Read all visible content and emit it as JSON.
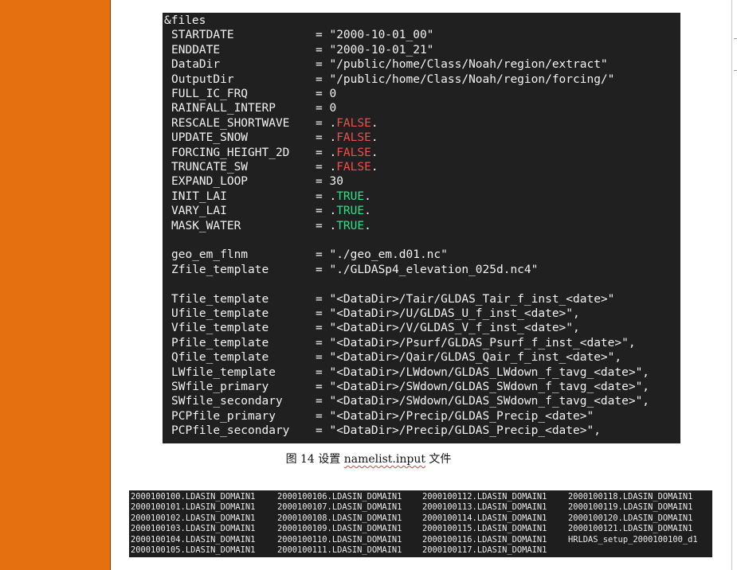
{
  "namelist": {
    "header": "&files",
    "entries": [
      {
        "key": "STARTDATE",
        "eq": "=",
        "value": [
          {
            "t": "\"2000-10-01_00\""
          }
        ]
      },
      {
        "key": "ENDDATE",
        "eq": "=",
        "value": [
          {
            "t": "\"2000-10-01_21\""
          }
        ]
      },
      {
        "key": "DataDir",
        "eq": "=",
        "value": [
          {
            "t": "\"/public/home/Class/Noah/region/extract\""
          }
        ]
      },
      {
        "key": "OutputDir",
        "eq": "=",
        "value": [
          {
            "t": "\"/public/home/Class/Noah/region/forcing/\""
          }
        ]
      },
      {
        "key": "FULL_IC_FRQ",
        "eq": "=",
        "value": [
          {
            "t": "0"
          }
        ]
      },
      {
        "key": "RAINFALL_INTERP",
        "eq": "=",
        "value": [
          {
            "t": "0"
          }
        ]
      },
      {
        "key": "RESCALE_SHORTWAVE",
        "eq": "=",
        "value": [
          {
            "t": "."
          },
          {
            "t": "FALSE",
            "c": "red"
          },
          {
            "t": "."
          }
        ]
      },
      {
        "key": "UPDATE_SNOW",
        "eq": "=",
        "value": [
          {
            "t": "."
          },
          {
            "t": "FALSE",
            "c": "red"
          },
          {
            "t": "."
          }
        ]
      },
      {
        "key": "FORCING_HEIGHT_2D",
        "eq": "=",
        "value": [
          {
            "t": "."
          },
          {
            "t": "FALSE",
            "c": "red"
          },
          {
            "t": "."
          }
        ]
      },
      {
        "key": "TRUNCATE_SW",
        "eq": "=",
        "value": [
          {
            "t": "."
          },
          {
            "t": "FALSE",
            "c": "red"
          },
          {
            "t": "."
          }
        ]
      },
      {
        "key": "EXPAND_LOOP",
        "eq": "=",
        "value": [
          {
            "t": "30"
          }
        ]
      },
      {
        "key": "INIT_LAI",
        "eq": "=",
        "value": [
          {
            "t": "."
          },
          {
            "t": "TRUE",
            "c": "green"
          },
          {
            "t": "."
          }
        ]
      },
      {
        "key": "VARY_LAI",
        "eq": "=",
        "value": [
          {
            "t": "."
          },
          {
            "t": "TRUE",
            "c": "green"
          },
          {
            "t": "."
          }
        ]
      },
      {
        "key": "MASK_WATER",
        "eq": "=",
        "value": [
          {
            "t": "."
          },
          {
            "t": "TRUE",
            "c": "green"
          },
          {
            "t": "."
          }
        ]
      },
      null,
      {
        "key": "geo_em_flnm",
        "eq": "=",
        "value": [
          {
            "t": "\"./geo_em.d01.nc\""
          }
        ]
      },
      {
        "key": "Zfile_template",
        "eq": "=",
        "value": [
          {
            "t": "\"./GLDASp4_elevation_025d.nc4\""
          }
        ]
      },
      null,
      {
        "key": "Tfile_template",
        "eq": "=",
        "value": [
          {
            "t": "\"<DataDir>/Tair/GLDAS_Tair_f_inst_<date>\""
          }
        ]
      },
      {
        "key": "Ufile_template",
        "eq": "=",
        "value": [
          {
            "t": "\"<DataDir>/U/GLDAS_U_f_inst_<date>\","
          }
        ]
      },
      {
        "key": "Vfile_template",
        "eq": "=",
        "value": [
          {
            "t": "\"<DataDir>/V/GLDAS_V_f_inst_<date>\","
          }
        ]
      },
      {
        "key": "Pfile_template",
        "eq": "=",
        "value": [
          {
            "t": "\"<DataDir>/Psurf/GLDAS_Psurf_f_inst_<date>\","
          }
        ]
      },
      {
        "key": "Qfile_template",
        "eq": "=",
        "value": [
          {
            "t": "\"<DataDir>/Qair/GLDAS_Qair_f_inst_<date>\","
          }
        ]
      },
      {
        "key": "LWfile_template",
        "eq": "=",
        "value": [
          {
            "t": "\"<DataDir>/LWdown/GLDAS_LWdown_f_tavg_<date>\","
          }
        ]
      },
      {
        "key": "SWfile_primary",
        "eq": "=",
        "value": [
          {
            "t": "\"<DataDir>/SWdown/GLDAS_SWdown_f_tavg_<date>\","
          }
        ]
      },
      {
        "key": "SWfile_secondary",
        "eq": "=",
        "value": [
          {
            "t": "\"<DataDir>/SWdown/GLDAS_SWdown_f_tavg_<date>\","
          }
        ]
      },
      {
        "key": "PCPfile_primary",
        "eq": "=",
        "value": [
          {
            "t": "\"<DataDir>/Precip/GLDAS_Precip_<date>\""
          }
        ]
      },
      {
        "key": "PCPfile_secondary",
        "eq": "=",
        "value": [
          {
            "t": "\"<DataDir>/Precip/GLDAS_Precip_<date>\","
          }
        ]
      }
    ]
  },
  "caption": {
    "prefix": "图  14  设置 ",
    "underlined": "namelist.input",
    "suffix": " 文件"
  },
  "file_listing": {
    "columns": [
      [
        "2000100100.LDASIN_DOMAIN1",
        "2000100101.LDASIN_DOMAIN1",
        "2000100102.LDASIN_DOMAIN1",
        "2000100103.LDASIN_DOMAIN1",
        "2000100104.LDASIN_DOMAIN1",
        "2000100105.LDASIN_DOMAIN1"
      ],
      [
        "2000100106.LDASIN_DOMAIN1",
        "2000100107.LDASIN_DOMAIN1",
        "2000100108.LDASIN_DOMAIN1",
        "2000100109.LDASIN_DOMAIN1",
        "2000100110.LDASIN_DOMAIN1",
        "2000100111.LDASIN_DOMAIN1"
      ],
      [
        "2000100112.LDASIN_DOMAIN1",
        "2000100113.LDASIN_DOMAIN1",
        "2000100114.LDASIN_DOMAIN1",
        "2000100115.LDASIN_DOMAIN1",
        "2000100116.LDASIN_DOMAIN1",
        "2000100117.LDASIN_DOMAIN1"
      ],
      [
        "2000100118.LDASIN_DOMAIN1",
        "2000100119.LDASIN_DOMAIN1",
        "2000100120.LDASIN_DOMAIN1",
        "2000100121.LDASIN_DOMAIN1",
        "HRLDAS_setup_2000100100_d1"
      ]
    ]
  },
  "colors": {
    "sidebar": "#e5700f",
    "terminal_bg": "#202020",
    "false_red": "#ef4e4e",
    "true_green": "#2ee08a"
  }
}
